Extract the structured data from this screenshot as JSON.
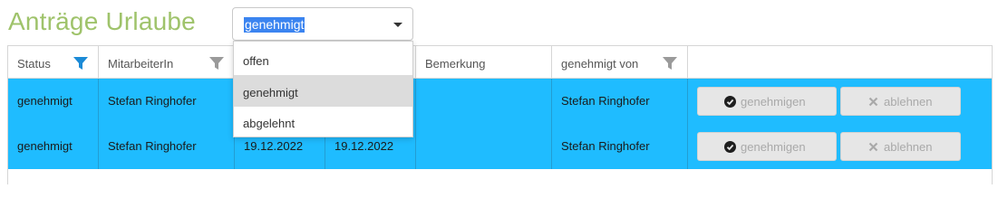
{
  "page": {
    "title": "Anträge Urlaube"
  },
  "status_select": {
    "value": "genehmigt",
    "options": [
      "offen",
      "genehmigt",
      "abgelehnt"
    ],
    "active_option": "genehmigt"
  },
  "table": {
    "columns": [
      "Status",
      "MitarbeiterIn",
      "",
      "",
      "Bemerkung",
      "genehmigt von",
      ""
    ],
    "rows": [
      {
        "status": "genehmigt",
        "employee": "Stefan Ringhofer",
        "from": "",
        "to": "",
        "remark": "",
        "approved_by": "Stefan Ringhofer"
      },
      {
        "status": "genehmigt",
        "employee": "Stefan Ringhofer",
        "from": "19.12.2022",
        "to": "19.12.2022",
        "remark": "",
        "approved_by": "Stefan Ringhofer"
      }
    ],
    "approve_label": "genehmigen",
    "reject_label": "ablehnen"
  },
  "colors": {
    "title": "#9fc36b",
    "row_selected": "#1fbcff",
    "filter_active": "#1b8ad6",
    "filter_inactive": "#9a9a9a"
  }
}
